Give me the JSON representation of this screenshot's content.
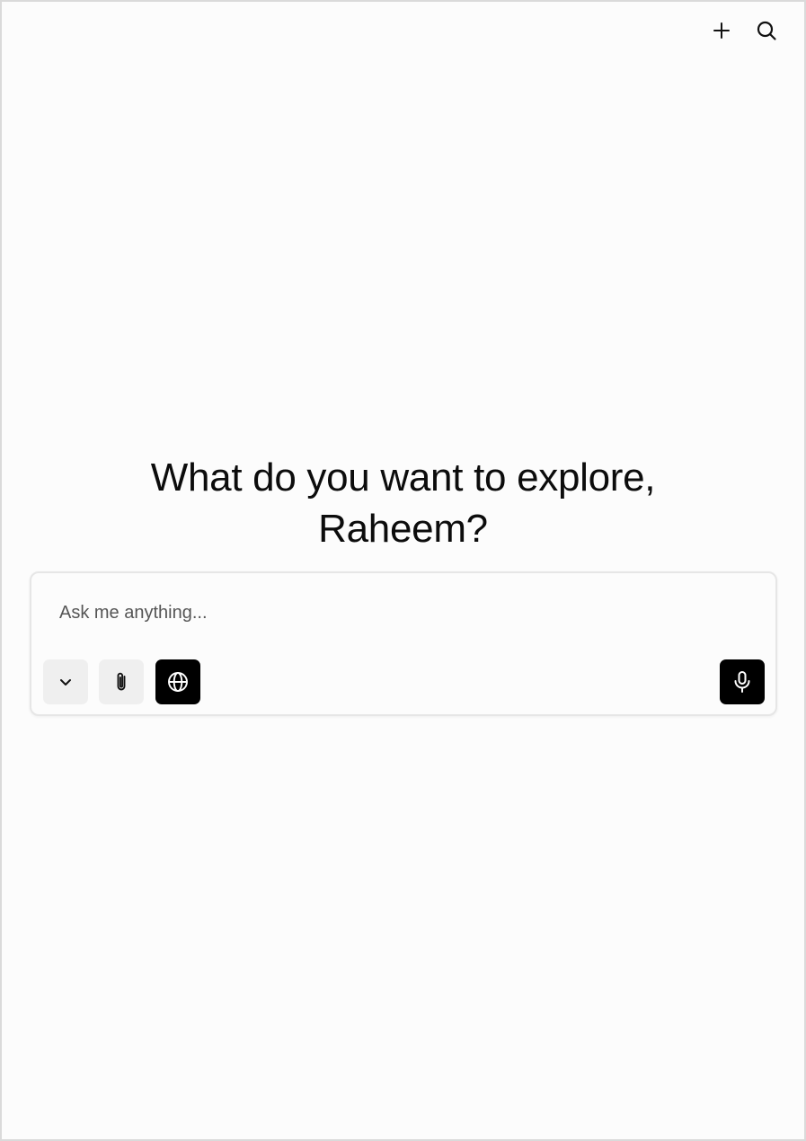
{
  "header": {
    "actions": [
      {
        "icon": "plus-icon",
        "label": "New"
      },
      {
        "icon": "search-icon",
        "label": "Search"
      }
    ]
  },
  "greeting": {
    "line1": "What do you want to explore,",
    "line2": "Raheem?"
  },
  "composer": {
    "placeholder": "Ask me anything...",
    "value": "",
    "tools": {
      "model_selector": {
        "icon": "chevron-down-icon"
      },
      "attach": {
        "icon": "paperclip-icon"
      },
      "web_search": {
        "icon": "globe-icon",
        "active": true
      },
      "voice": {
        "icon": "microphone-icon"
      }
    }
  },
  "colors": {
    "background": "#fcfcfc",
    "text": "#0c0c0c",
    "button_light": "#efefef",
    "button_dark": "#000000",
    "border": "#e6e6e6"
  }
}
